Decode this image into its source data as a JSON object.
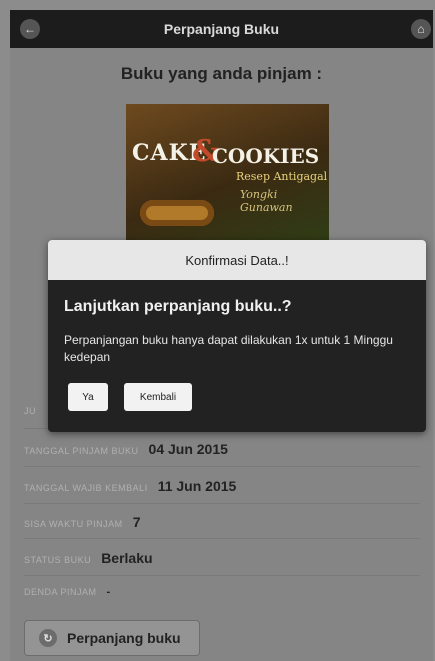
{
  "header": {
    "title": "Perpanjang Buku",
    "back_icon": "←",
    "home_icon": "⌂"
  },
  "main": {
    "subtitle": "Buku yang anda pinjam :"
  },
  "cover": {
    "cake": "CAKE",
    "amp": "&",
    "cookies": "COOKIES",
    "subtitle": "Resep Antigagal",
    "author": "Yongki Gunawan"
  },
  "details": {
    "partial_label": "JU",
    "tanggal_pinjam_label": "TANGGAL PINJAM BUKU",
    "tanggal_pinjam_value": "04 Jun 2015",
    "tanggal_kembali_label": "TANGGAL WAJIB KEMBALI",
    "tanggal_kembali_value": "11 Jun 2015",
    "sisa_waktu_label": "SISA WAKTU PINJAM",
    "sisa_waktu_value": "7",
    "status_label": "STATUS BUKU",
    "status_value": "Berlaku",
    "denda_label": "DENDA PINJAM",
    "denda_value": "-"
  },
  "extend_button": {
    "label": "Perpanjang buku",
    "icon": "↻"
  },
  "dialog": {
    "title": "Konfirmasi Data..!",
    "question": "Lanjutkan perpanjang buku..?",
    "message": "Perpanjangan buku hanya dapat dilakukan 1x untuk 1 Minggu kedepan",
    "yes_label": "Ya",
    "back_label": "Kembali"
  }
}
